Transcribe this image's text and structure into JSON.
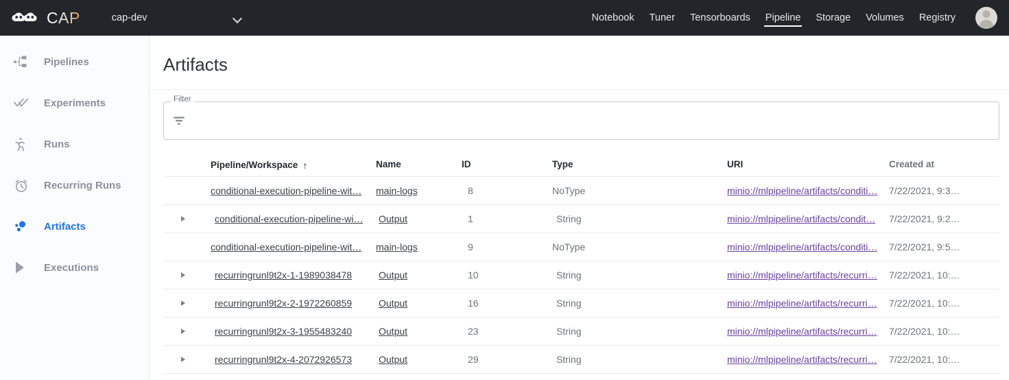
{
  "topbar": {
    "brand_text": "CAP",
    "namespace": "cap-dev",
    "nav": [
      {
        "label": "Notebook",
        "active": false
      },
      {
        "label": "Tuner",
        "active": false
      },
      {
        "label": "Tensorboards",
        "active": false
      },
      {
        "label": "Pipeline",
        "active": true
      },
      {
        "label": "Storage",
        "active": false
      },
      {
        "label": "Volumes",
        "active": false
      },
      {
        "label": "Registry",
        "active": false
      }
    ]
  },
  "sidebar": {
    "items": [
      {
        "label": "Pipelines",
        "icon": "pipelines-icon",
        "active": false
      },
      {
        "label": "Experiments",
        "icon": "double-check-icon",
        "active": false
      },
      {
        "label": "Runs",
        "icon": "runner-icon",
        "active": false
      },
      {
        "label": "Recurring Runs",
        "icon": "alarm-clock-icon",
        "active": false
      },
      {
        "label": "Artifacts",
        "icon": "artifacts-dots-icon",
        "active": true
      },
      {
        "label": "Executions",
        "icon": "play-triangle-icon",
        "active": false
      }
    ]
  },
  "main": {
    "page_title": "Artifacts",
    "filter": {
      "legend": "Filter",
      "value": "",
      "placeholder": ""
    },
    "table": {
      "headers": {
        "pipeline": "Pipeline/Workspace",
        "sort_indicator": "↑",
        "name": "Name",
        "id": "ID",
        "type": "Type",
        "uri": "URI",
        "created": "Created at"
      },
      "rows": [
        {
          "expandable": false,
          "pipeline": "conditional-execution-pipeline-wit…",
          "name": "main-logs",
          "id": "8",
          "type": "NoType",
          "uri": "minio://mlpipeline/artifacts/conditi…",
          "created": "7/22/2021, 9:3…"
        },
        {
          "expandable": true,
          "pipeline": "conditional-execution-pipeline-wi…",
          "name": "Output",
          "id": "1",
          "type": "String",
          "uri": "minio://mlpipeline/artifacts/condit…",
          "created": "7/22/2021, 9:2…"
        },
        {
          "expandable": false,
          "pipeline": "conditional-execution-pipeline-wit…",
          "name": "main-logs",
          "id": "9",
          "type": "NoType",
          "uri": "minio://mlpipeline/artifacts/conditi…",
          "created": "7/22/2021, 9:5…"
        },
        {
          "expandable": true,
          "pipeline": "recurringrunl9t2x-1-1989038478",
          "name": "Output",
          "id": "10",
          "type": "String",
          "uri": "minio://mlpipeline/artifacts/recurri…",
          "created": "7/22/2021, 10:…"
        },
        {
          "expandable": true,
          "pipeline": "recurringrunl9t2x-2-1972260859",
          "name": "Output",
          "id": "16",
          "type": "String",
          "uri": "minio://mlpipeline/artifacts/recurri…",
          "created": "7/22/2021, 10:…"
        },
        {
          "expandable": true,
          "pipeline": "recurringrunl9t2x-3-1955483240",
          "name": "Output",
          "id": "23",
          "type": "String",
          "uri": "minio://mlpipeline/artifacts/recurri…",
          "created": "7/22/2021, 10:…"
        },
        {
          "expandable": true,
          "pipeline": "recurringrunl9t2x-4-2072926573",
          "name": "Output",
          "id": "29",
          "type": "String",
          "uri": "minio://mlpipeline/artifacts/recurri…",
          "created": "7/22/2021, 10:…"
        }
      ]
    }
  },
  "colors": {
    "topbar_bg": "#22262b",
    "accent_blue": "#2272e8",
    "link_purple": "#6a3fa0",
    "muted_text": "#6c7278",
    "sidebar_text": "#8a9199"
  }
}
